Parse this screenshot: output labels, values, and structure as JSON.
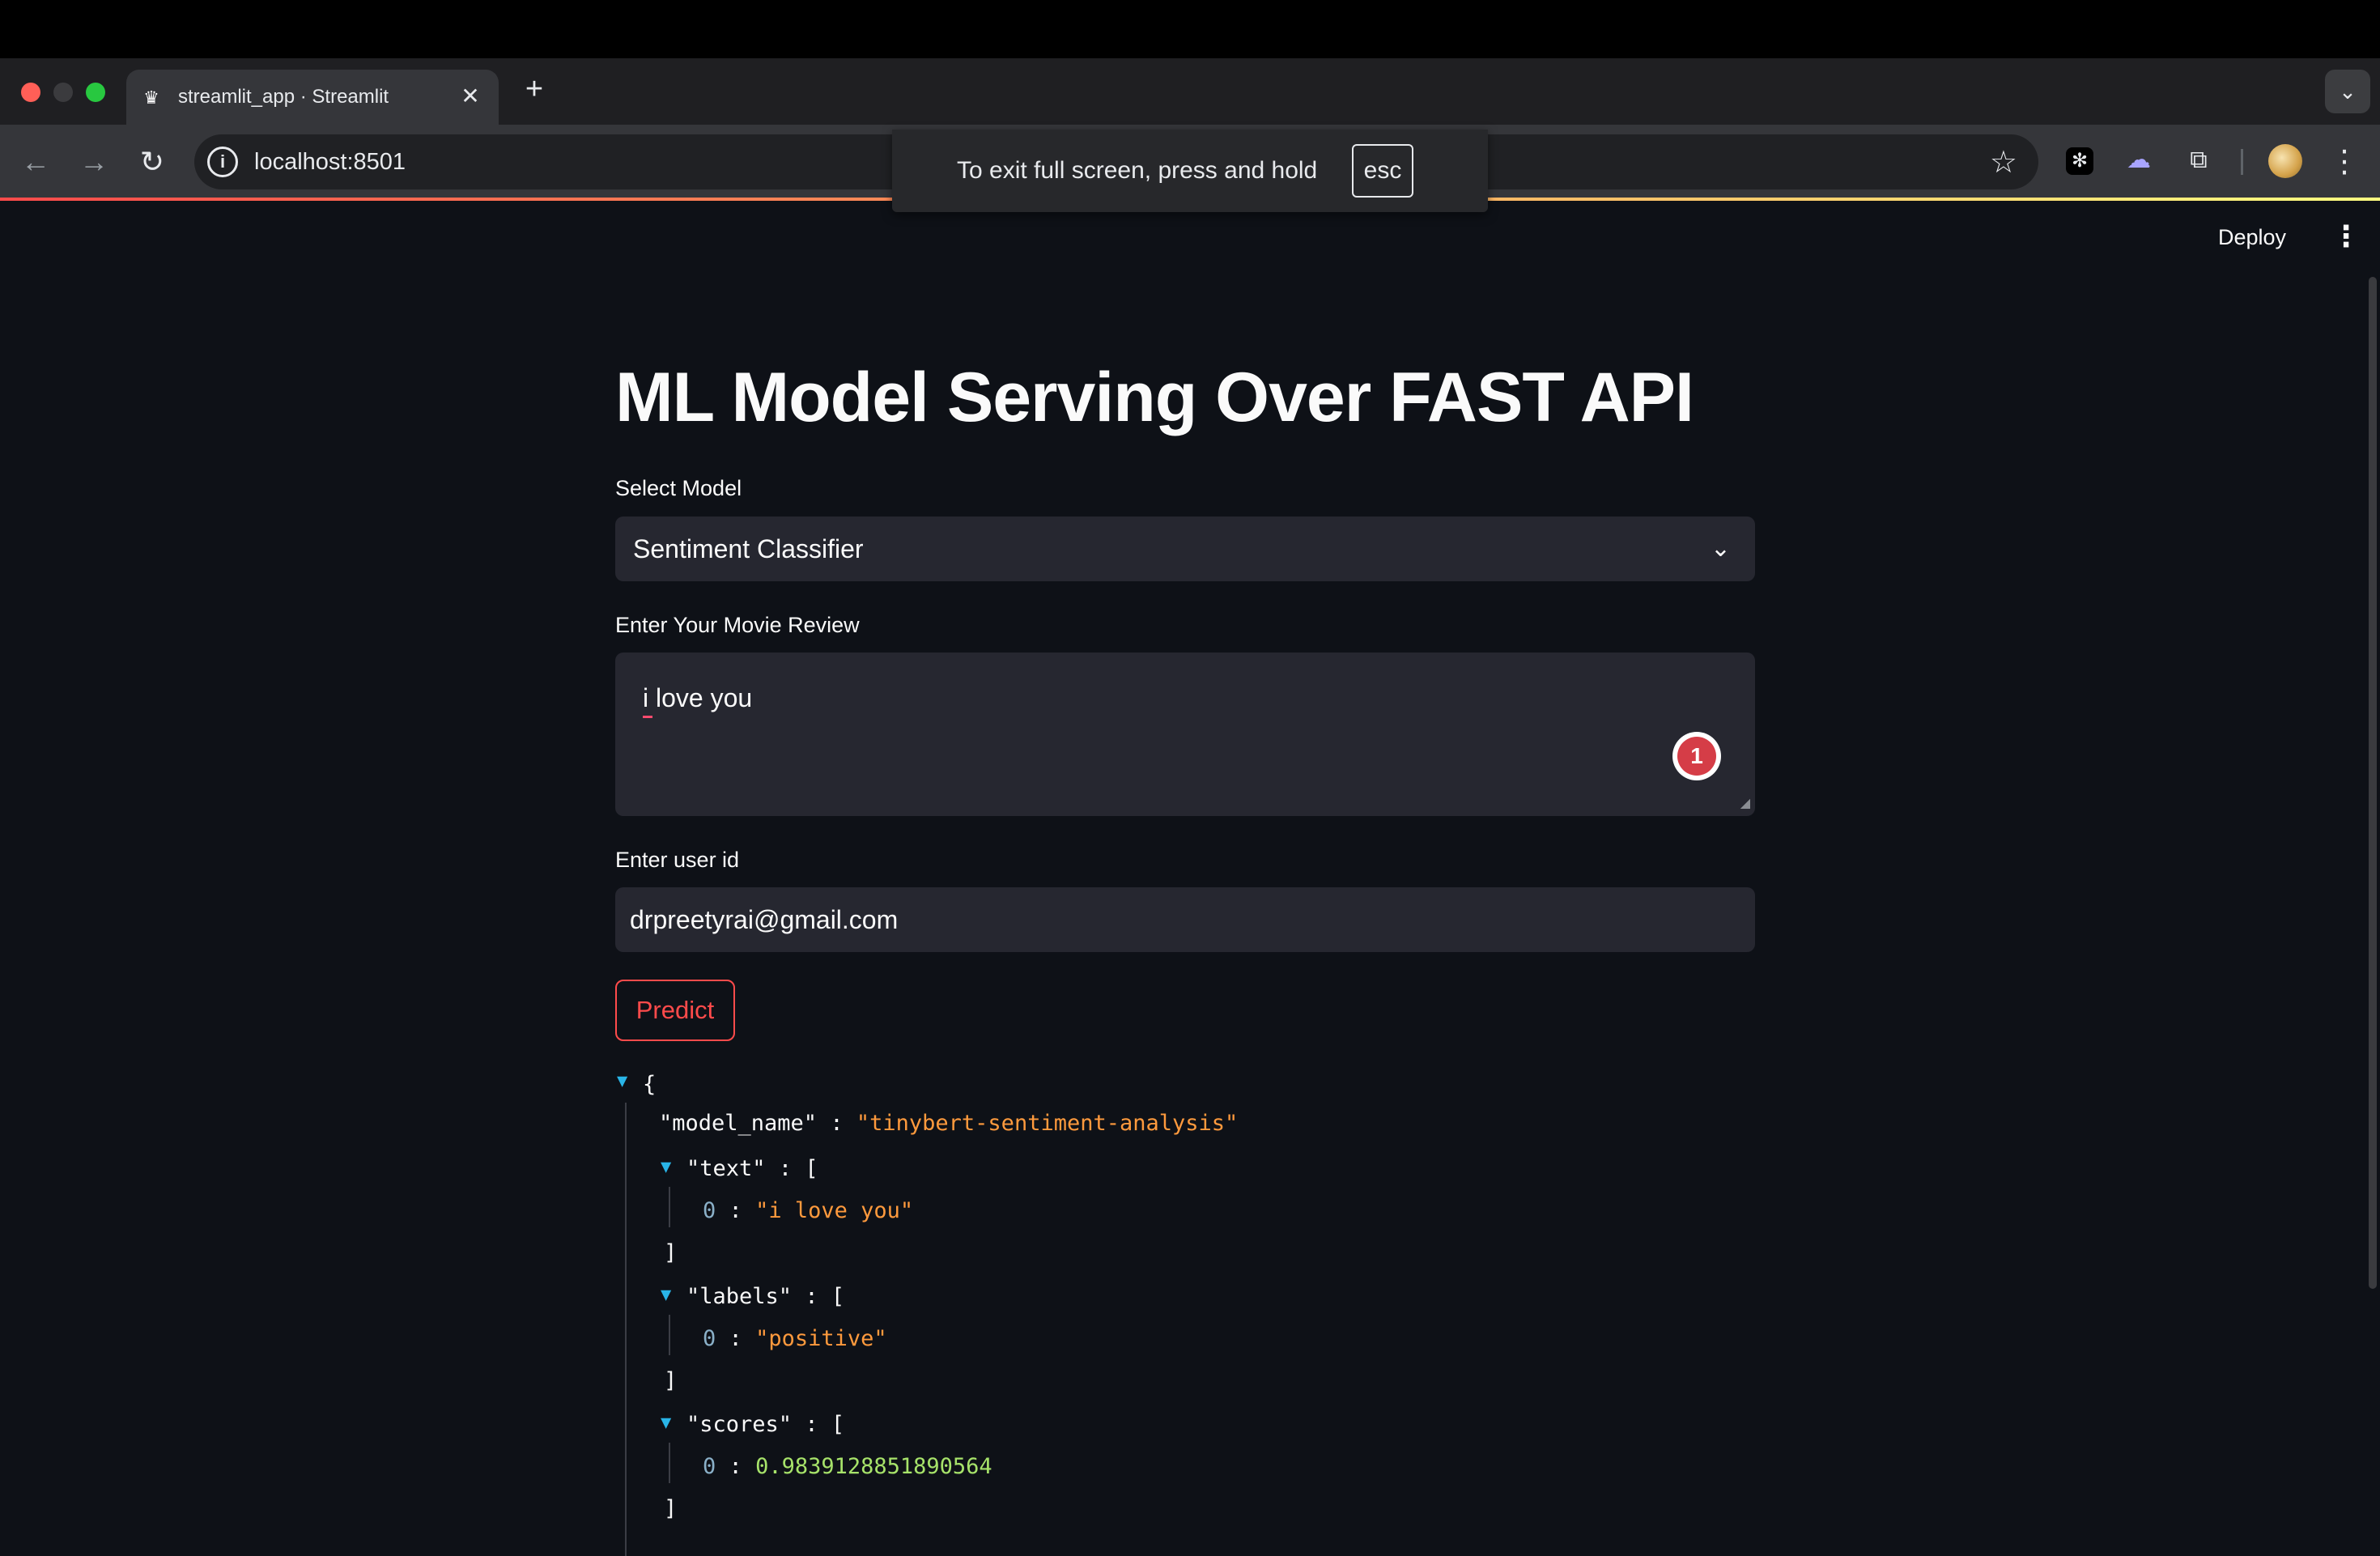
{
  "browser": {
    "tab_title": "streamlit_app · Streamlit",
    "tab_close": "✕",
    "new_tab": "+",
    "tab_list": "⌄",
    "url": "localhost:8501",
    "site_info_glyph": "i",
    "back_glyph": "←",
    "forward_glyph": "→",
    "reload_glyph": "↻",
    "star_glyph": "☆",
    "menu_glyph": "⋮",
    "fullscreen_toast": {
      "text": "To exit full screen, press and hold",
      "key": "esc"
    }
  },
  "streamlit_header": {
    "deploy_label": "Deploy",
    "menu_glyph": "⋮"
  },
  "main": {
    "title": "ML Model Serving Over FAST API",
    "model_select": {
      "label": "Select Model",
      "value": "Sentiment Classifier",
      "chevron": "⌄"
    },
    "review": {
      "label": "Enter Your Movie Review",
      "value": "i love you",
      "grammarly_count": "1"
    },
    "user_id": {
      "label": "Enter user id",
      "value": "drpreetyrai@gmail.com"
    },
    "predict_label": "Predict"
  },
  "json_output": {
    "open_brace": "{",
    "model_name_key": "\"model_name\"",
    "model_name_value": "\"tinybert-sentiment-analysis\"",
    "text_key": "\"text\"",
    "text_0": "\"i love you\"",
    "labels_key": "\"labels\"",
    "labels_0": "\"positive\"",
    "scores_key": "\"scores\"",
    "scores_0": "0.9839128851890564",
    "colon": ":",
    "open_bracket": "[",
    "close_bracket": "]",
    "index_0": "0"
  },
  "colors": {
    "background": "#0e1117",
    "accent": "#ff4b4b",
    "input_bg": "#262730",
    "json_string": "#ff9a3d",
    "json_number": "#a7e36a"
  }
}
